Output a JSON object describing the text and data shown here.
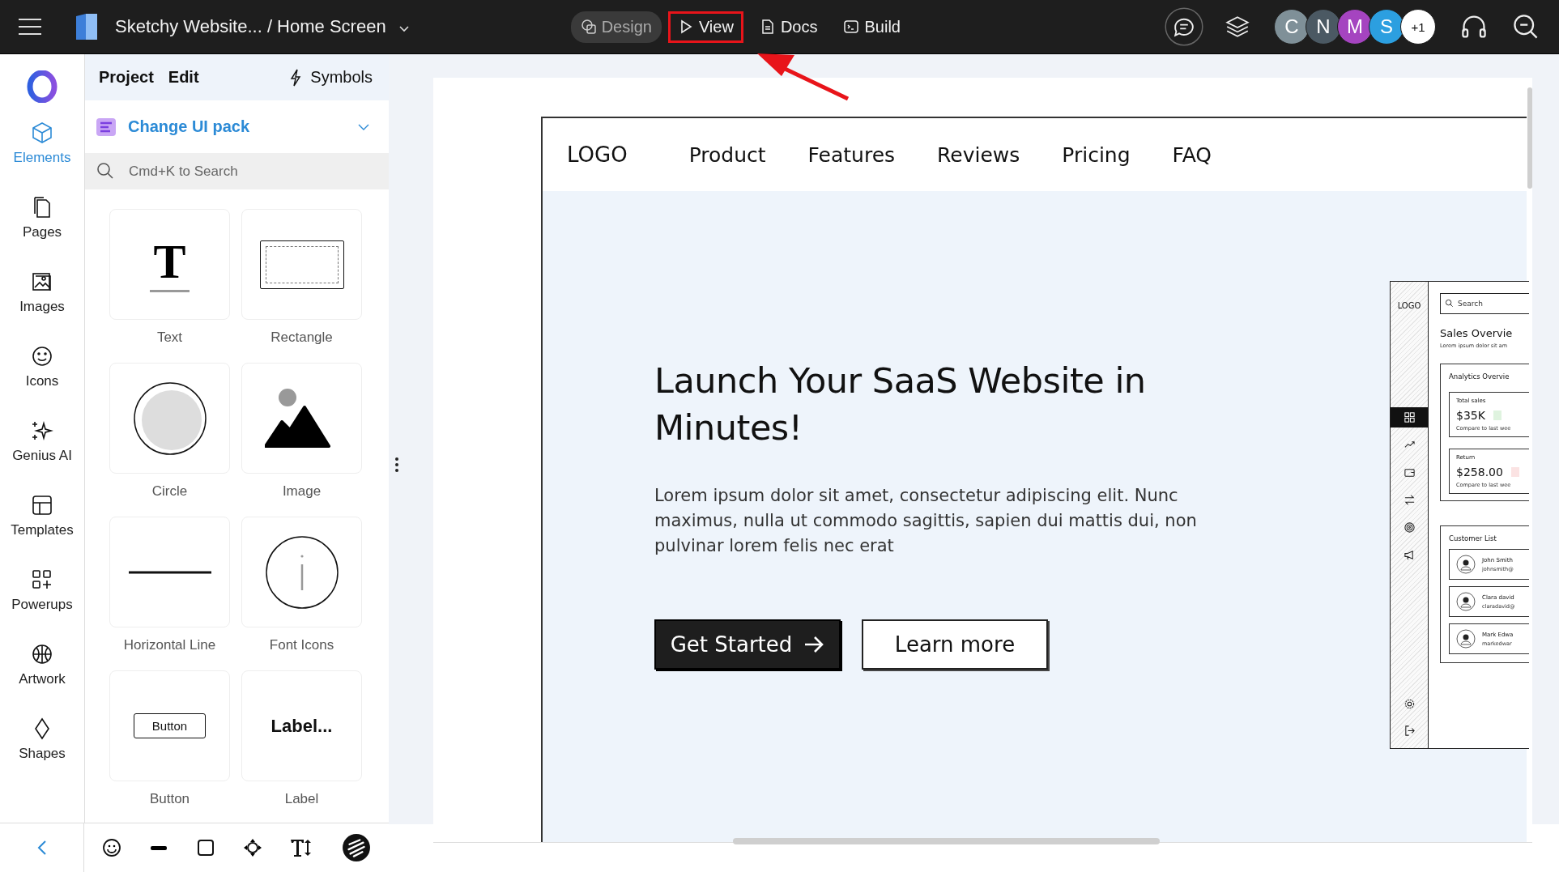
{
  "topbar": {
    "title": "Sketchy Website... / Home Screen",
    "modes": [
      {
        "label": "Design",
        "kind": "design",
        "selected": true,
        "highlighted": false
      },
      {
        "label": "View",
        "kind": "view",
        "selected": false,
        "highlighted": true
      },
      {
        "label": "Docs",
        "kind": "docs",
        "selected": false,
        "highlighted": false
      },
      {
        "label": "Build",
        "kind": "build",
        "selected": false,
        "highlighted": false
      }
    ],
    "avatars": [
      {
        "initial": "C",
        "color": "#7f9098"
      },
      {
        "initial": "N",
        "color": "#4b5963"
      },
      {
        "initial": "M",
        "color": "#a544c0"
      },
      {
        "initial": "S",
        "color": "#2c9fe0"
      },
      {
        "initial": "+1",
        "color": "#ffffff"
      }
    ]
  },
  "rail": {
    "items": [
      {
        "label": "Elements",
        "kind": "elements",
        "selected": true
      },
      {
        "label": "Pages",
        "kind": "pages",
        "selected": false
      },
      {
        "label": "Images",
        "kind": "images",
        "selected": false
      },
      {
        "label": "Icons",
        "kind": "icons",
        "selected": false
      },
      {
        "label": "Genius AI",
        "kind": "genius",
        "selected": false
      },
      {
        "label": "Templates",
        "kind": "templates",
        "selected": false
      },
      {
        "label": "Powerups",
        "kind": "powerups",
        "selected": false
      },
      {
        "label": "Artwork",
        "kind": "artwork",
        "selected": false
      },
      {
        "label": "Shapes",
        "kind": "shapes",
        "selected": false
      }
    ]
  },
  "panel": {
    "tabs": [
      "Project",
      "Edit"
    ],
    "symbols": "Symbols",
    "ui_pack": "Change UI pack",
    "search": {
      "placeholder": "Cmd+K to Search"
    },
    "tiles": [
      {
        "label": "Text",
        "kind": "text",
        "preview": "T"
      },
      {
        "label": "Rectangle",
        "kind": "rectangle"
      },
      {
        "label": "Circle",
        "kind": "circle"
      },
      {
        "label": "Image",
        "kind": "image"
      },
      {
        "label": "Horizontal Line",
        "kind": "line"
      },
      {
        "label": "Font Icons",
        "kind": "fonticon"
      },
      {
        "label": "Button",
        "kind": "button",
        "preview": "Button"
      },
      {
        "label": "Label",
        "kind": "label",
        "preview": "Label..."
      }
    ]
  },
  "canvas": {
    "nav": [
      "LOGO",
      "Product",
      "Features",
      "Reviews",
      "Pricing",
      "FAQ"
    ],
    "headline": "Launch Your SaaS Website in Minutes!",
    "paragraph": "Lorem ipsum dolor sit amet, consectetur adipiscing elit. Nunc maximus, nulla ut commodo sagittis, sapien dui mattis dui, non pulvinar lorem felis nec erat",
    "buttons": [
      {
        "label": "Get Started",
        "kind": "primary"
      },
      {
        "label": "Learn more",
        "kind": "secondary"
      }
    ],
    "dashboard": {
      "logo": "LOGO",
      "search": {
        "placeholder": "Search"
      },
      "title": "Sales Overvie",
      "subtitle": "Lorem ipsum dolor sit am",
      "nav_icons": [
        {
          "kind": "grid",
          "selected": true
        },
        {
          "kind": "trend",
          "selected": false
        },
        {
          "kind": "wallet",
          "selected": false
        },
        {
          "kind": "swap",
          "selected": false
        },
        {
          "kind": "target",
          "selected": false
        },
        {
          "kind": "megaphone",
          "selected": false
        }
      ],
      "analytics_title": "Analytics Overvie",
      "stats": [
        {
          "label": "Total sales",
          "value": "$35K",
          "note": "Compare to last wee",
          "color": "#dff3df"
        },
        {
          "label": "Return",
          "value": "$258.00",
          "note": "Compare to last wee",
          "color": "#fbe3e3"
        }
      ],
      "customers_title": "Customer List",
      "customers": [
        {
          "name": "John Smith",
          "email": "johnsmith@"
        },
        {
          "name": "Clara david",
          "email": "claradavid@"
        },
        {
          "name": "Mark Edwa",
          "email": "markedwar"
        }
      ]
    }
  }
}
